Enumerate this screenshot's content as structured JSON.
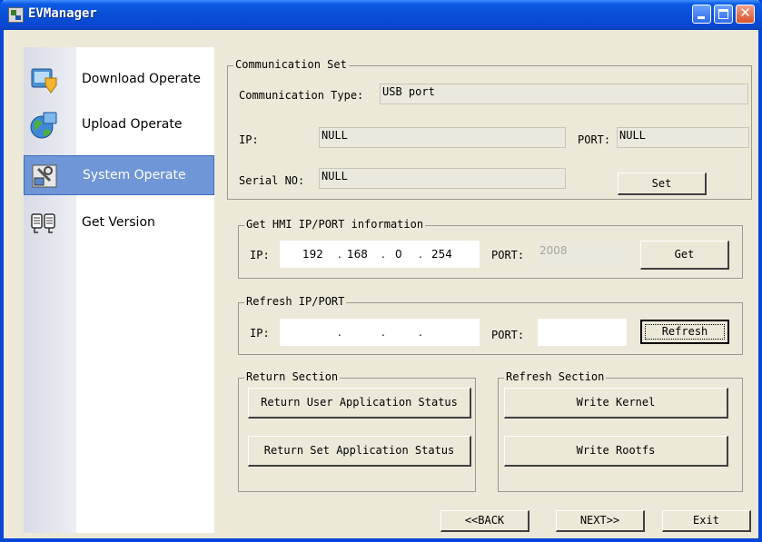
{
  "window": {
    "title": "EVManager"
  },
  "sidebar": {
    "items": [
      {
        "label": "Download Operate",
        "icon": "download-icon"
      },
      {
        "label": "Upload Operate",
        "icon": "upload-globe-icon"
      },
      {
        "label": "System Operate",
        "icon": "system-tools-icon",
        "active": true
      },
      {
        "label": "Get Version",
        "icon": "version-icon"
      }
    ]
  },
  "communication": {
    "legend": "Communication Set",
    "type_label": "Communication Type:",
    "type_value": "USB port",
    "ip_label": "IP:",
    "ip_value": "NULL",
    "port_label": "PORT:",
    "port_value": "NULL",
    "serial_label": "Serial NO:",
    "serial_value": "NULL",
    "set_button": "Set"
  },
  "get_hmi": {
    "legend": "Get HMI IP/PORT information",
    "ip_label": "IP:",
    "ip": [
      "192",
      "168",
      "0",
      "254"
    ],
    "port_label": "PORT:",
    "port_value": "2008",
    "get_button": "Get"
  },
  "refresh_ip": {
    "legend": "Refresh IP/PORT",
    "ip_label": "IP:",
    "ip": [
      "",
      "",
      "",
      ""
    ],
    "port_label": "PORT:",
    "port_value": "",
    "refresh_button": "Refresh"
  },
  "return_section": {
    "legend": "Return Section",
    "user_button": "Return User Application Status",
    "set_button": "Return Set Application Status"
  },
  "refresh_section": {
    "legend": "Refresh Section",
    "kernel_button": "Write Kernel",
    "rootfs_button": "Write Rootfs"
  },
  "footer": {
    "back_button": "<<BACK",
    "next_button": "NEXT>>",
    "exit_button": "Exit"
  },
  "colors": {
    "titlebar": "#0a4fd6",
    "selection": "#6f96d6",
    "face": "#ece9d8"
  }
}
